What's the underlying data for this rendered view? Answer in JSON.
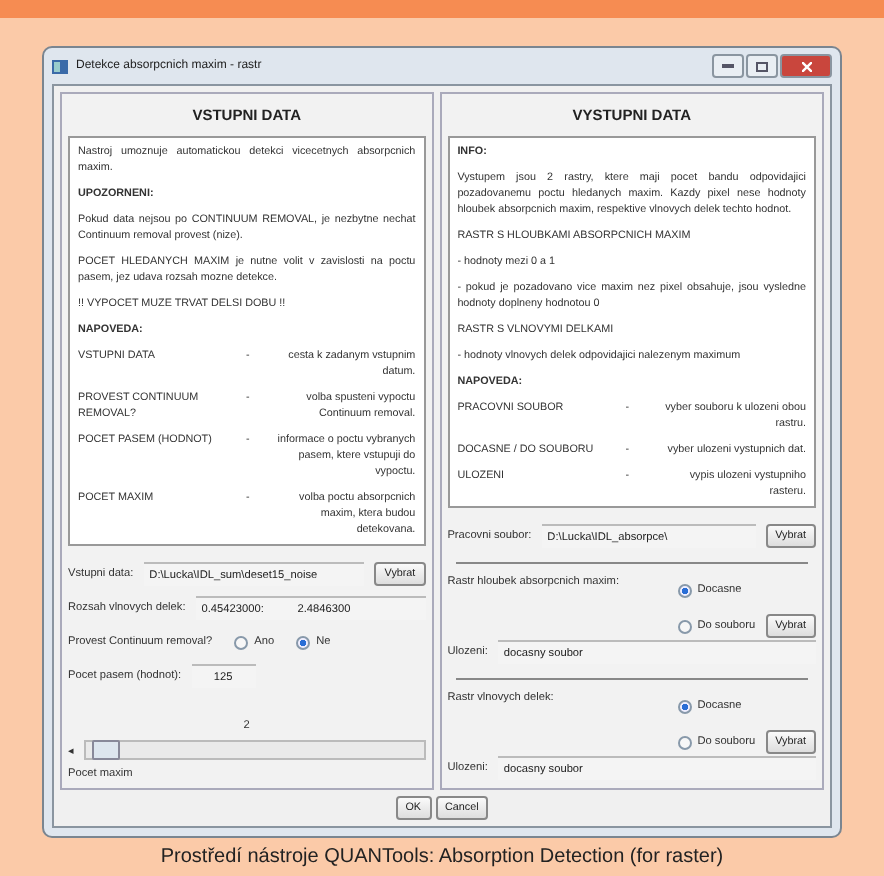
{
  "window": {
    "title": "Detekce absorpcnich maxim - rastr"
  },
  "input_panel": {
    "heading": "VSTUPNI DATA",
    "help": [
      {
        "kind": "para",
        "text": "Nastroj umoznuje automatickou detekci vicecetnych absorpcnich maxim."
      },
      {
        "kind": "heading",
        "text": "UPOZORNENI:"
      },
      {
        "kind": "para",
        "text": "Pokud data  nejsou po CONTINUUM REMOVAL, je nezbytne nechat Continuum removal  provest  (nize)."
      },
      {
        "kind": "para",
        "text": "POCET HLEDANYCH MAXIM je nutne volit v zavislosti na poctu pasem, jez udava rozsah mozne detekce."
      },
      {
        "kind": "para",
        "text": "!! VYPOCET MUZE TRVAT DELSI DOBU !!"
      },
      {
        "kind": "heading",
        "text": "NAPOVEDA:"
      },
      {
        "kind": "pair",
        "term": "VSTUPNI DATA",
        "dash": "-",
        "desc": "cesta k zadanym vstupnim datum."
      },
      {
        "kind": "pair",
        "term": "PROVEST CONTINUUM REMOVAL?",
        "dash": "-",
        "desc": "volba spusteni vypoctu Continuum removal."
      },
      {
        "kind": "pair",
        "term": "POCET PASEM (HODNOT)",
        "dash": "-",
        "desc": "informace o poctu vybranych pasem, ktere vstupuji do vypoctu."
      },
      {
        "kind": "pair",
        "term": "POCET MAXIM",
        "dash": "-",
        "desc": "volba poctu absorpcnich maxim, ktera budou detekovana."
      }
    ],
    "input_file": {
      "label": "Vstupni data:",
      "value": "D:\\Lucka\\IDL_sum\\deset15_noise",
      "button": "Vybrat"
    },
    "range": {
      "label": "Rozsah vlnovych delek:",
      "from": "0.45423000:",
      "to": "2.4846300"
    },
    "continuum": {
      "label": "Provest Continuum removal?",
      "options": [
        {
          "label": "Ano",
          "selected": false
        },
        {
          "label": "Ne",
          "selected": true
        }
      ]
    },
    "bands": {
      "label": "Pocet pasem (hodnot):",
      "value": "125"
    },
    "maxima": {
      "value": "2",
      "arrow": "◂",
      "label": "Pocet maxim",
      "level": 0.02
    }
  },
  "output_panel": {
    "heading": "VYSTUPNI DATA",
    "help": [
      {
        "kind": "heading",
        "text": "INFO:"
      },
      {
        "kind": "para",
        "text": "Vystupem jsou 2 rastry, ktere maji pocet bandu odpovidajici pozadovanemu poctu hledanych maxim. Kazdy pixel nese hodnoty hloubek absorpcnich maxim, respektive vlnovych delek techto hodnot."
      },
      {
        "kind": "line",
        "text": "RASTR S HLOUBKAMI ABSORPCNICH MAXIM"
      },
      {
        "kind": "line",
        "text": "- hodnoty mezi 0 a 1"
      },
      {
        "kind": "para",
        "text": "- pokud je pozadovano vice maxim nez pixel obsahuje, jsou vysledne hodnoty doplneny hodnotou 0"
      },
      {
        "kind": "line",
        "text": "RASTR S VLNOVYMI DELKAMI"
      },
      {
        "kind": "line",
        "text": "- hodnoty vlnovych delek odpovidajici nalezenym maximum"
      },
      {
        "kind": "heading",
        "text": "NAPOVEDA:"
      },
      {
        "kind": "pair",
        "term": "PRACOVNI SOUBOR",
        "dash": "-",
        "desc": "vyber souboru k ulozeni obou rastru."
      },
      {
        "kind": "pair",
        "term": "DOCASNE / DO SOUBORU",
        "dash": "-",
        "desc": "vyber ulozeni vystupnich dat."
      },
      {
        "kind": "pair",
        "term": "ULOZENI",
        "dash": "-",
        "desc": "vypis ulozeni vystupniho rasteru."
      }
    ],
    "work_file": {
      "label": "Pracovni soubor:",
      "value": "D:\\Lucka\\IDL_absorpce\\",
      "button": "Vybrat"
    },
    "rasters": [
      {
        "label": "Rastr hloubek absorpcnich maxim:",
        "options": [
          {
            "label": "Docasne",
            "selected": true
          },
          {
            "label": "Do souboru",
            "selected": false
          }
        ],
        "button": "Vybrat",
        "save_label": "Ulozeni:",
        "save_value": "docasny soubor"
      },
      {
        "label": "Rastr vlnovych delek:",
        "options": [
          {
            "label": "Docasne",
            "selected": true
          },
          {
            "label": "Do souboru",
            "selected": false
          }
        ],
        "button": "Vybrat",
        "save_label": "Ulozeni:",
        "save_value": "docasny soubor"
      }
    ]
  },
  "buttons": [
    "OK",
    "Cancel"
  ],
  "caption": "Prostředí nástroje QUANTools: Absorption Detection (for raster)"
}
